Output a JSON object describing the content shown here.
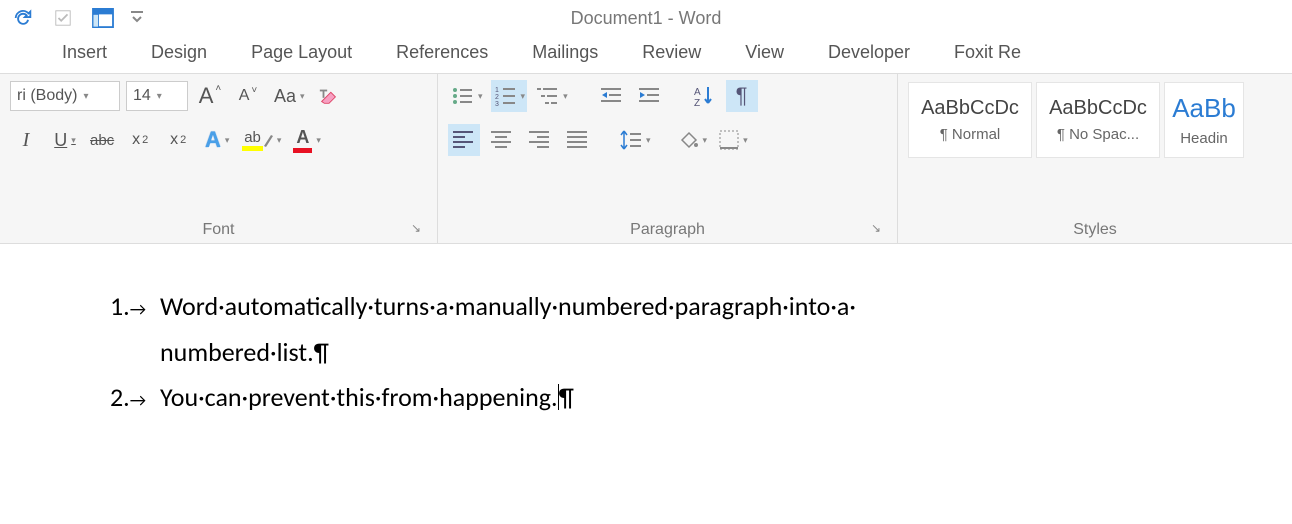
{
  "window_title": "Document1 - Word",
  "tabs": [
    "Insert",
    "Design",
    "Page Layout",
    "References",
    "Mailings",
    "Review",
    "View",
    "Developer",
    "Foxit Re"
  ],
  "font_group": {
    "label": "Font",
    "font_name": "ri (Body)",
    "font_size": "14",
    "grow": "A",
    "shrink": "A",
    "case": "Aa",
    "italic_i": "I",
    "underline_u": "U",
    "strike": "abc",
    "sub": "x",
    "sub2": "2",
    "sup": "x",
    "sup2": "2",
    "texteff": "A",
    "hilite": "ab",
    "fontcolor": "A"
  },
  "para_group": {
    "label": "Paragraph"
  },
  "styles_group": {
    "label": "Styles",
    "items": [
      {
        "preview": "AaBbCcDc",
        "label": "¶ Normal"
      },
      {
        "preview": "AaBbCcDc",
        "label": "¶ No Spac..."
      },
      {
        "preview": "AaBb",
        "label": "Headin"
      }
    ]
  },
  "doc": {
    "line1_num": "1.",
    "line1_text": "Word·automatically·turns·a·manually·numbered·paragraph·into·a·",
    "line1_text2": "numbered·list.¶",
    "line2_num": "2.",
    "line2_text": "You·can·prevent·this·from·happening.",
    "pilcrow": "¶",
    "tab": "→"
  }
}
